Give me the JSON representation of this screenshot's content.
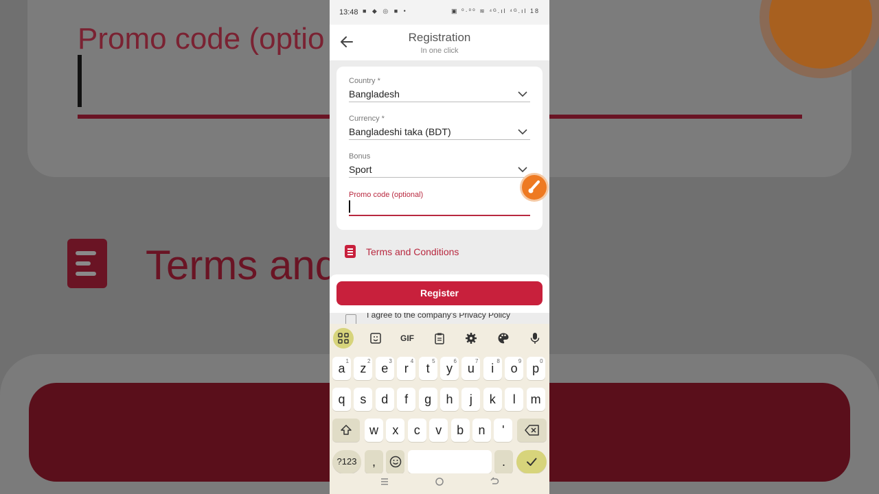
{
  "background": {
    "promo_text": "Promo code (optio",
    "terms_text": "Terms and"
  },
  "status_bar": {
    "time": "13:48",
    "icons_left": "■ ◆ ◎ ■ •",
    "icons_right": "▣ ⁰·⁰⁰ ≋ ⁴ᴳ.ıl ⁴ᴳ.ıl 18"
  },
  "header": {
    "title": "Registration",
    "subtitle": "In one click"
  },
  "form": {
    "country": {
      "label": "Country *",
      "value": "Bangladesh"
    },
    "currency": {
      "label": "Currency *",
      "value": "Bangladeshi taka (BDT)"
    },
    "bonus": {
      "label": "Bonus",
      "value": "Sport"
    },
    "promo": {
      "label": "Promo code (optional)",
      "value": ""
    }
  },
  "terms_link": "Terms and Conditions",
  "register_button": "Register",
  "privacy_checkbox": "I agree to the company's Privacy Policy",
  "keyboard": {
    "toolbar": [
      "apps-icon",
      "sticker-icon",
      "GIF",
      "clipboard-icon",
      "settings-icon",
      "palette-icon",
      "mic-icon"
    ],
    "gif_label": "GIF",
    "row1": [
      {
        "k": "a",
        "n": "1"
      },
      {
        "k": "z",
        "n": "2"
      },
      {
        "k": "e",
        "n": "3"
      },
      {
        "k": "r",
        "n": "4"
      },
      {
        "k": "t",
        "n": "5"
      },
      {
        "k": "y",
        "n": "6"
      },
      {
        "k": "u",
        "n": "7"
      },
      {
        "k": "i",
        "n": "8"
      },
      {
        "k": "o",
        "n": "9"
      },
      {
        "k": "p",
        "n": "0"
      }
    ],
    "row2": [
      "q",
      "s",
      "d",
      "f",
      "g",
      "h",
      "j",
      "k",
      "l",
      "m"
    ],
    "row3": [
      "w",
      "x",
      "c",
      "v",
      "b",
      "n",
      "'"
    ],
    "sym_label": "?123",
    "comma": ",",
    "period": "."
  }
}
